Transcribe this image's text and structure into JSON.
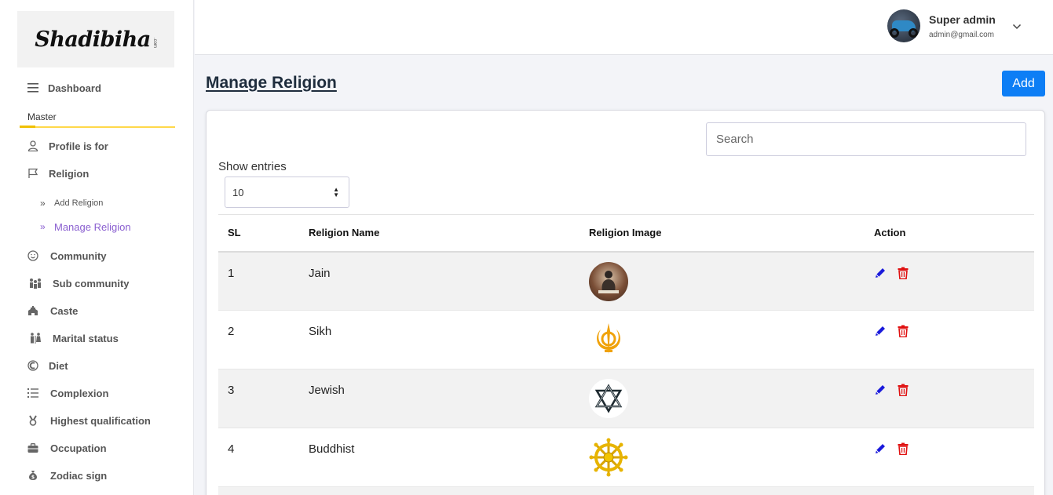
{
  "brand": {
    "logo_text": "Shadibiha",
    "logo_sub": ".com"
  },
  "sidebar": {
    "dashboard": "Dashboard",
    "section": "Master",
    "items": [
      {
        "label": "Profile is for",
        "icon": "user-icon"
      },
      {
        "label": "Religion",
        "icon": "flag-icon"
      }
    ],
    "sub_items": [
      {
        "label": "Add Religion"
      },
      {
        "label": "Manage Religion"
      }
    ],
    "more_items": [
      {
        "label": "Community",
        "icon": "smile-icon"
      },
      {
        "label": "Sub community",
        "icon": "people-icon"
      },
      {
        "label": "Caste",
        "icon": "building-icon"
      },
      {
        "label": "Marital status",
        "icon": "couple-icon"
      },
      {
        "label": "Diet",
        "icon": "diet-icon"
      },
      {
        "label": "Complexion",
        "icon": "list-icon"
      },
      {
        "label": "Highest qualification",
        "icon": "medal-icon"
      },
      {
        "label": "Occupation",
        "icon": "briefcase-icon"
      },
      {
        "label": "Zodiac sign",
        "icon": "money-bag-icon"
      }
    ]
  },
  "header": {
    "user_name": "Super admin",
    "user_email": "admin@gmail.com"
  },
  "main": {
    "title": "Manage Religion",
    "add_label": "Add",
    "search_placeholder": "Search",
    "show_entries_label": "Show entries",
    "entries_value": "10",
    "columns": [
      "SL",
      "Religion Name",
      "Religion Image",
      "Action"
    ],
    "rows": [
      {
        "sl": "1",
        "name": "Jain",
        "image": "jain-statue-image"
      },
      {
        "sl": "2",
        "name": "Sikh",
        "image": "khanda-symbol-image"
      },
      {
        "sl": "3",
        "name": "Jewish",
        "image": "star-of-david-image"
      },
      {
        "sl": "4",
        "name": "Buddhist",
        "image": "dharma-wheel-image"
      }
    ]
  },
  "colors": {
    "accent": "#0d7ef5",
    "active_nav": "#8a5fd0",
    "edit": "#1a1adb",
    "delete": "#e01010",
    "section_line": "#ffd84a"
  }
}
